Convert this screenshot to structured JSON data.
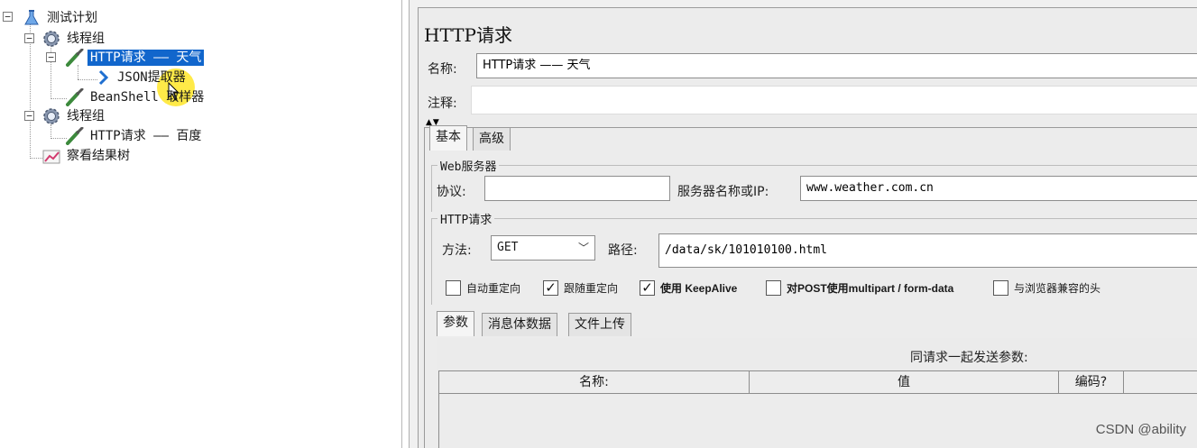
{
  "tree": {
    "items": [
      {
        "label": "测试计划"
      },
      {
        "label": "线程组"
      },
      {
        "label": "HTTP请求 —— 天气"
      },
      {
        "label": "JSON提取器"
      },
      {
        "label": "BeanShell 取样器"
      },
      {
        "label": "线程组"
      },
      {
        "label": "HTTP请求 —— 百度"
      },
      {
        "label": "察看结果树"
      }
    ],
    "toggle_expanded": "−"
  },
  "editor": {
    "title": "HTTP请求",
    "name_label": "名称:",
    "name_value": "HTTP请求 —— 天气",
    "comment_label": "注释:",
    "comment_value": "",
    "tabs": [
      {
        "label": "基本"
      },
      {
        "label": "高级"
      }
    ],
    "web_server": {
      "group_title": "Web服务器",
      "protocol_label": "协议:",
      "protocol_value": "",
      "server_label": "服务器名称或IP:",
      "server_value": "www.weather.com.cn"
    },
    "http_request": {
      "group_title": "HTTP请求",
      "method_label": "方法:",
      "method_value": "GET",
      "path_label": "路径:",
      "path_value": "/data/sk/101010100.html"
    },
    "checkboxes": [
      {
        "label": "自动重定向",
        "checked": false,
        "mark": ""
      },
      {
        "label": "跟随重定向",
        "checked": true,
        "mark": "✓"
      },
      {
        "label": "使用 KeepAlive",
        "checked": true,
        "mark": "✓"
      },
      {
        "label": "对POST使用multipart / form-data",
        "checked": false,
        "mark": ""
      },
      {
        "label": "与浏览器兼容的头",
        "checked": false,
        "mark": ""
      }
    ],
    "sub_tabs": [
      {
        "label": "参数"
      },
      {
        "label": "消息体数据"
      },
      {
        "label": "文件上传"
      }
    ],
    "params_caption": "同请求一起发送参数:",
    "table_headers": [
      "名称:",
      "值",
      "编码?",
      ""
    ]
  },
  "watermark": "CSDN @ability",
  "colors": {
    "selection": "#1166cc",
    "panel_bg": "#ececec",
    "cursor_highlight": "#ffe628"
  }
}
